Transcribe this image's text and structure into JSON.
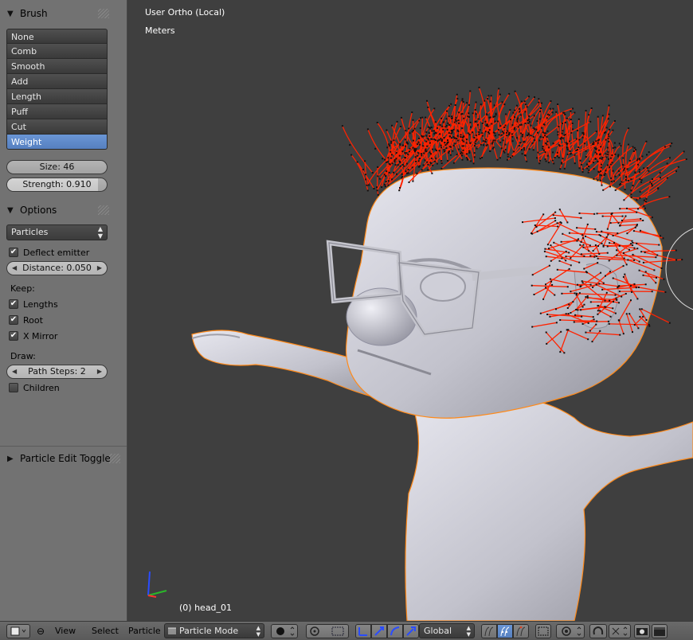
{
  "brush_panel": {
    "title": "Brush",
    "items": [
      "None",
      "Comb",
      "Smooth",
      "Add",
      "Length",
      "Puff",
      "Cut",
      "Weight"
    ],
    "active_index": 7,
    "size_label": "Size: 46",
    "strength_label": "Strength: 0.910",
    "strength_fraction": 0.91
  },
  "options_panel": {
    "title": "Options",
    "edit_type": "Particles",
    "deflect_emitter_label": "Deflect emitter",
    "deflect_emitter_checked": true,
    "distance_label": "Distance: 0.050",
    "keep_label": "Keep:",
    "lengths_label": "Lengths",
    "lengths_checked": true,
    "root_label": "Root",
    "root_checked": true,
    "x_mirror_label": "X Mirror",
    "x_mirror_checked": true,
    "draw_label": "Draw:",
    "path_steps_label": "Path Steps: 2",
    "children_label": "Children",
    "children_checked": false
  },
  "toggle_panel": {
    "title": "Particle Edit Toggle"
  },
  "viewport": {
    "view_name": "User Ortho (Local)",
    "units": "Meters",
    "object_label": "(0) head_01",
    "colors": {
      "background": "#3f3f3f",
      "hair": "#ff2200",
      "mesh": "#c8c8d2",
      "outline": "#ff8a1a"
    }
  },
  "header": {
    "menus": [
      "View",
      "Select",
      "Particle"
    ],
    "mode": "Particle Mode",
    "orientation": "Global"
  },
  "colors": {
    "accent": "#5680c0",
    "panel": "#727272"
  }
}
